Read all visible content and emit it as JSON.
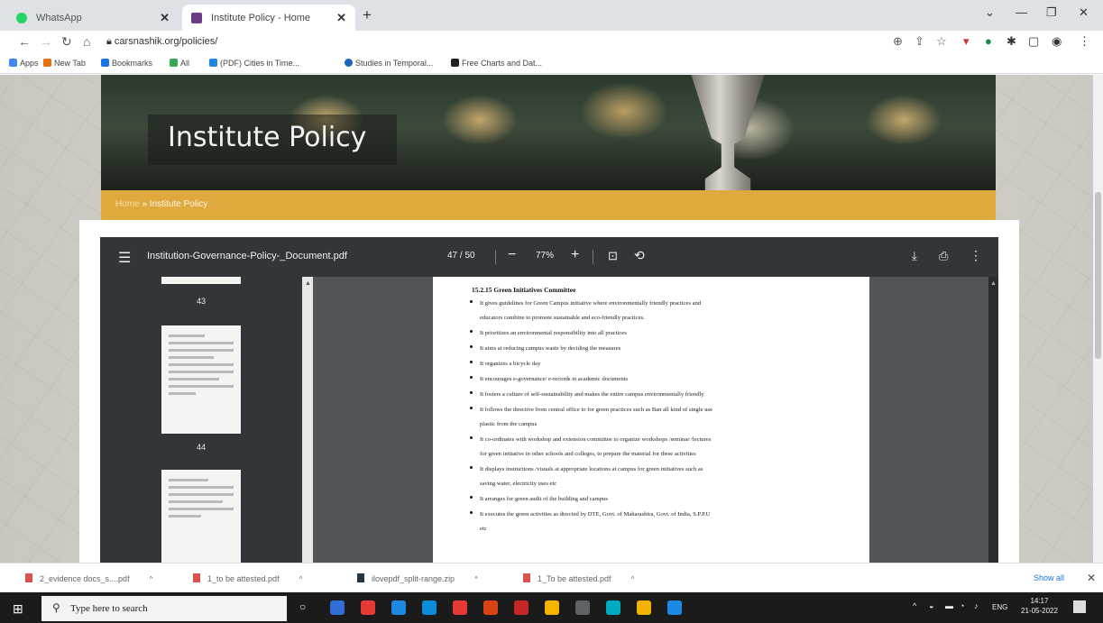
{
  "browser": {
    "tabs": [
      {
        "label": "WhatsApp",
        "favicon_color": "#25d366"
      },
      {
        "label": "Institute Policy - Home",
        "favicon_color": "#6b3b85"
      }
    ],
    "url": "carsnashik.org/policies/",
    "bookmarks": [
      {
        "label": "Apps",
        "color": "#4285f4"
      },
      {
        "label": "New Tab",
        "color": "#e8710a"
      },
      {
        "label": "Bookmarks",
        "color": "#1a73e8"
      },
      {
        "label": "All",
        "color": "#34a853"
      },
      {
        "label": "(PDF) Cities in Time...",
        "color": "#1e88e5"
      },
      {
        "label": "Studies in Temporal...",
        "color": "#1565c0"
      },
      {
        "label": "Free Charts and Dat...",
        "color": "#222222"
      }
    ]
  },
  "hero": {
    "title": "Institute Policy",
    "breadcrumb_home": "Home",
    "breadcrumb_sep": "»",
    "breadcrumb_current": "Institute Policy"
  },
  "pdf": {
    "filename": "Institution-Governance-Policy-_Document.pdf",
    "page_current": "47",
    "page_sep": "/",
    "page_total": "50",
    "zoom": "77%",
    "thumbs": [
      {
        "num": "43"
      },
      {
        "num": "44"
      }
    ],
    "document": {
      "heading": "15.2.15  Green Initiatives Committee",
      "items": [
        [
          "It gives guidelines for Green Campus initiative where environmentally friendly practices and",
          "educators combine to promote sustainable and eco-friendly practices."
        ],
        [
          "It prioritizes an environmental responsibility into all practices"
        ],
        [
          "It aims at reducing campus waste by deciding the measures"
        ],
        [
          "It organizes a bicycle day"
        ],
        [
          "It encourages e-governance/ e-records in academic documents"
        ],
        [
          "It fosters a culture of self-sustainability and makes the entire campus environmentally friendly"
        ],
        [
          "It follows the directive from central office to for green practices such as Ban all kind of single use",
          "plastic from the campus"
        ],
        [
          "It co-ordinates with workshop and extension committee to organize workshops /seminar /lectures",
          "for green initiative in other schools and colleges, to prepare the material for these activities"
        ],
        [
          "It displays instructions /visuals at appropriate locations at campus for green initiatives such as",
          "saving water, electricity uses etc"
        ],
        [
          "It arranges for green audit of the building and campus"
        ],
        [
          "It executes the green activities as directed by DTE, Govt. of Maharashtra, Govt. of India, S.P.P.U",
          "etc"
        ]
      ]
    }
  },
  "downloads": {
    "items": [
      {
        "label": "2_evidence docs_s....pdf",
        "type": "pdf"
      },
      {
        "label": "1_to be attested.pdf",
        "type": "pdf"
      },
      {
        "label": "ilovepdf_split-range.zip",
        "type": "zip"
      },
      {
        "label": "1_To be attested.pdf",
        "type": "pdf"
      }
    ],
    "show_all": "Show all"
  },
  "taskbar": {
    "search_placeholder": "Type here to search",
    "lang": "ENG",
    "time": "14:17",
    "date": "21-05-2022",
    "app_colors": [
      "#2f6fd6",
      "#e53935",
      "#1e88e5",
      "#0b8dd8",
      "#e53935",
      "#d84315",
      "#c62828",
      "#f4b400",
      "#5f6368",
      "#00acc1",
      "#f2b400",
      "#1e88e5"
    ]
  }
}
